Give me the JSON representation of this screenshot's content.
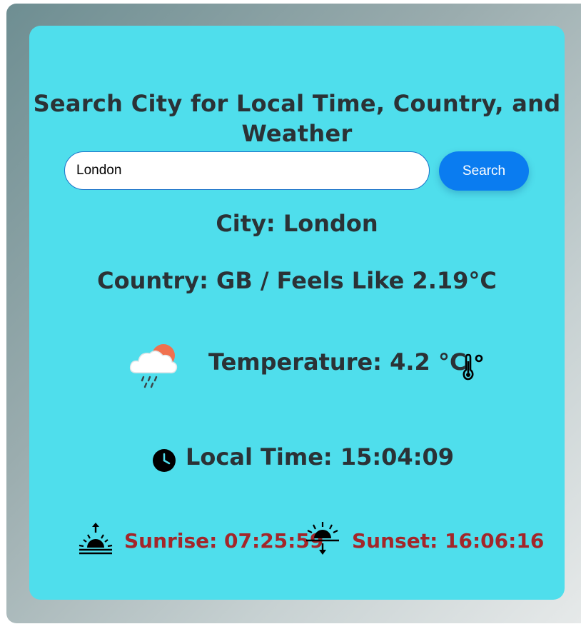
{
  "header": {
    "title": "Search City for Local Time, Country, and Weather"
  },
  "search": {
    "value": "London",
    "button_label": "Search"
  },
  "result": {
    "city": "City: London",
    "country_feels": "Country: GB / Feels Like 2.19°C",
    "temperature": "Temperature: 4.2 °C",
    "local_time": "Local Time: 15:04:09",
    "sunrise": "Sunrise: 07:25:59",
    "sunset": "Sunset: 16:06:16"
  },
  "icons": {
    "weather": "cloud-rain-sun-icon",
    "thermometer": "thermometer-icon",
    "clock": "clock-icon",
    "sunrise": "sunrise-icon",
    "sunset": "sunset-icon"
  },
  "colors": {
    "card_background": "#4fdeec",
    "button": "#0a7cf0",
    "sun_text": "#a3262a",
    "heading_text": "#2b3236"
  }
}
